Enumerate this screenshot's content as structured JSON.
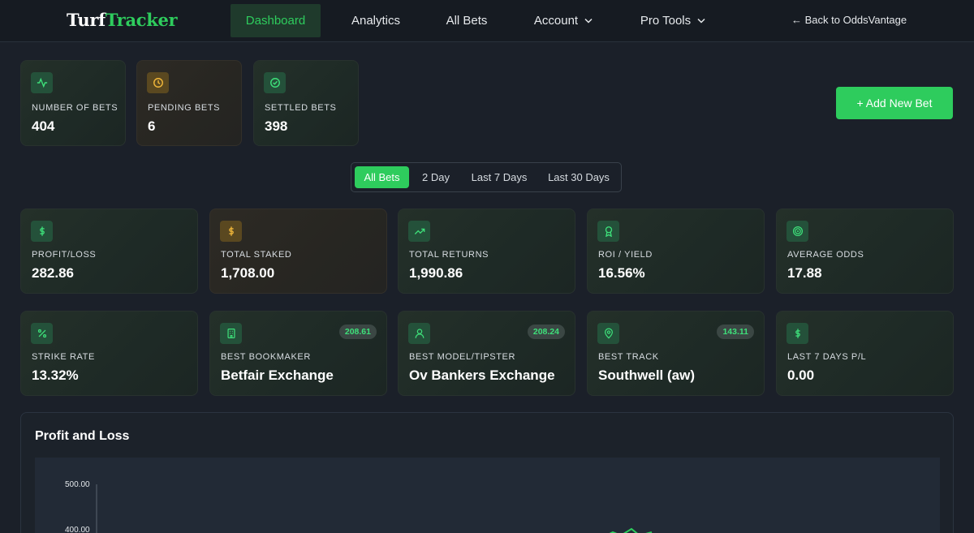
{
  "brand": {
    "part1": "Turf",
    "part2": "Tracker"
  },
  "nav": {
    "items": [
      "Dashboard",
      "Analytics",
      "All Bets",
      "Account",
      "Pro Tools"
    ],
    "active": "Dashboard",
    "back_link": "← Back to OddsVantage"
  },
  "summary": [
    {
      "label": "NUMBER OF BETS",
      "value": "404",
      "icon": "activity-icon"
    },
    {
      "label": "PENDING BETS",
      "value": "6",
      "icon": "clock-icon"
    },
    {
      "label": "SETTLED BETS",
      "value": "398",
      "icon": "check-circle-icon"
    }
  ],
  "add_bet_label": "+ Add New Bet",
  "filters": {
    "options": [
      "All Bets",
      "2 Day",
      "Last 7 Days",
      "Last 30 Days"
    ],
    "active": "All Bets"
  },
  "stats_row1": [
    {
      "label": "PROFIT/LOSS",
      "value": "282.86",
      "icon": "dollar-icon"
    },
    {
      "label": "TOTAL STAKED",
      "value": "1,708.00",
      "icon": "dollar-icon"
    },
    {
      "label": "TOTAL RETURNS",
      "value": "1,990.86",
      "icon": "trending-up-icon"
    },
    {
      "label": "ROI / YIELD",
      "value": "16.56%",
      "icon": "award-icon"
    },
    {
      "label": "AVERAGE ODDS",
      "value": "17.88",
      "icon": "target-icon"
    }
  ],
  "stats_row2": [
    {
      "label": "STRIKE RATE",
      "value": "13.32%",
      "icon": "percent-icon",
      "badge": ""
    },
    {
      "label": "BEST BOOKMAKER",
      "value": "Betfair Exchange",
      "icon": "building-icon",
      "badge": "208.61"
    },
    {
      "label": "BEST MODEL/TIPSTER",
      "value": "Ov Bankers Exchange",
      "icon": "user-icon",
      "badge": "208.24"
    },
    {
      "label": "BEST TRACK",
      "value": "Southwell (aw)",
      "icon": "map-pin-icon",
      "badge": "143.11"
    },
    {
      "label": "LAST 7 DAYS P/L",
      "value": "0.00",
      "icon": "dollar-icon",
      "badge": ""
    }
  ],
  "chart": {
    "title": "Profit and Loss",
    "y_ticks": [
      "500.00",
      "400.00"
    ]
  },
  "colors": {
    "accent": "#2ecc5d",
    "amber": "#f1b73a",
    "background": "#1b2029"
  }
}
